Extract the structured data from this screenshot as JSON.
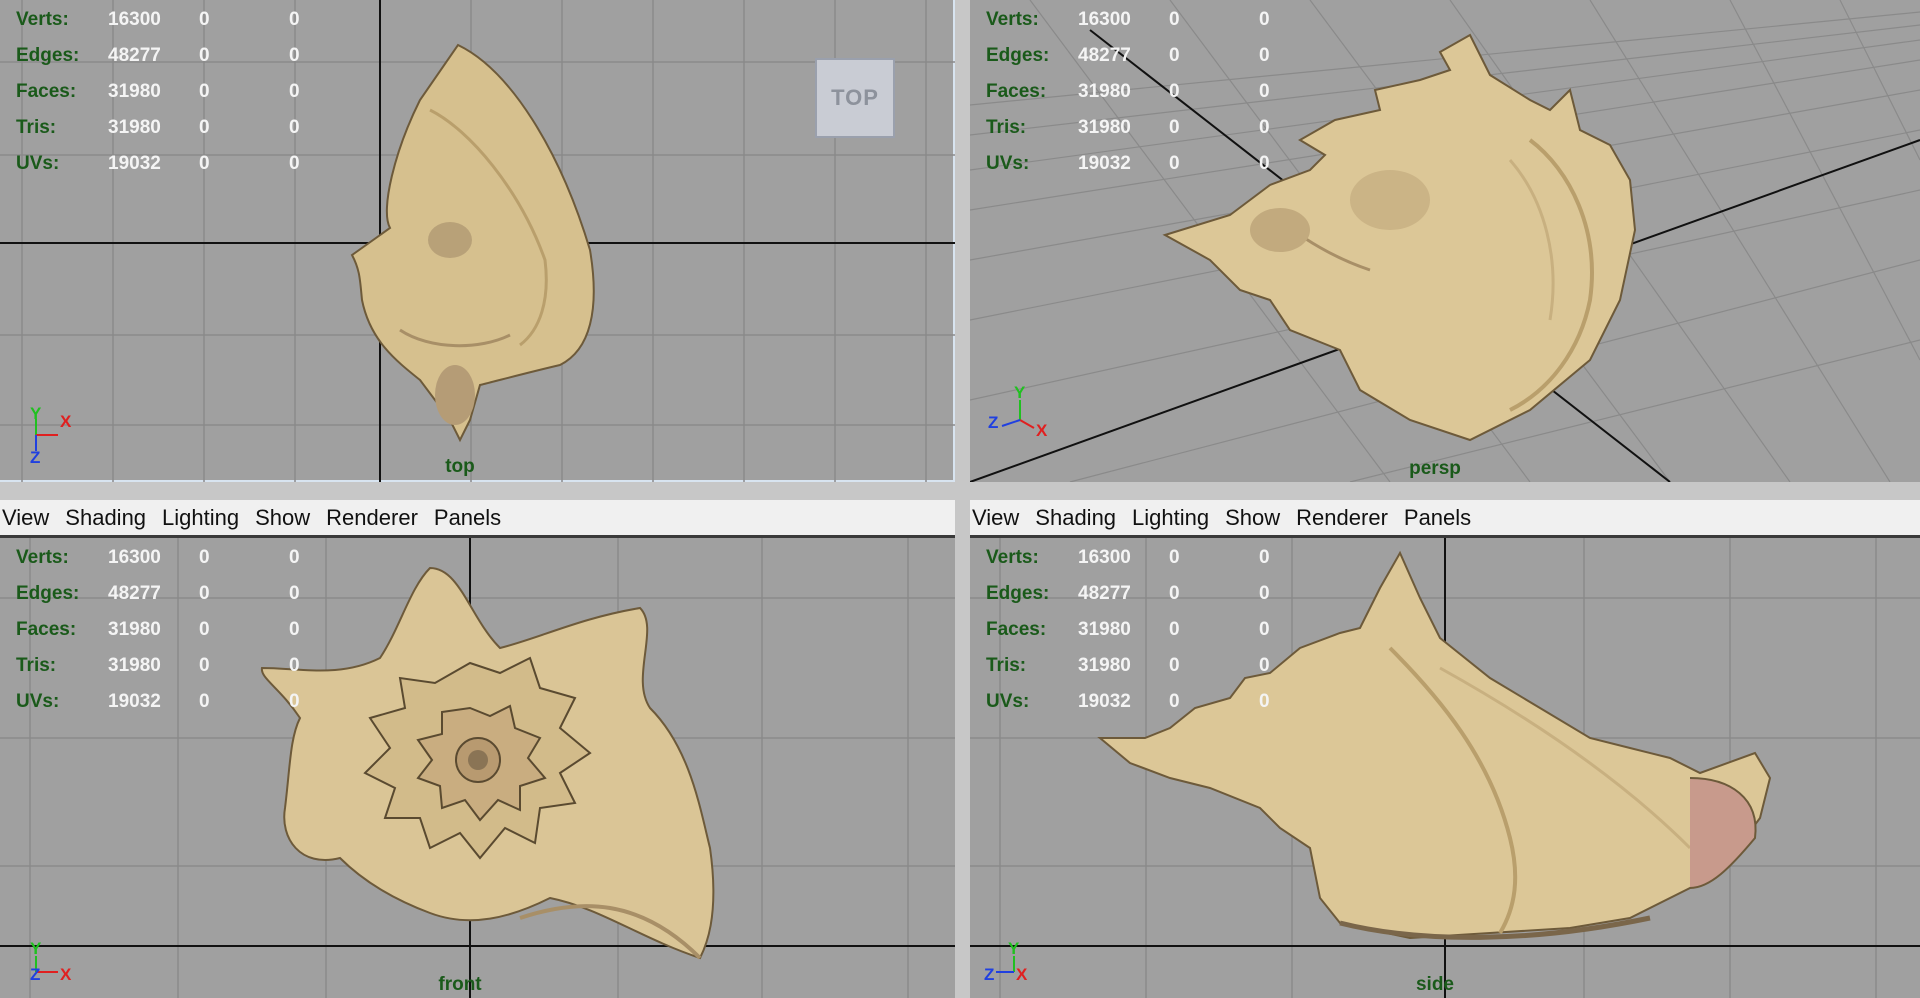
{
  "stats": {
    "labels": [
      "Verts:",
      "Edges:",
      "Faces:",
      "Tris:",
      "UVs:"
    ],
    "values": [
      "16300",
      "48277",
      "31980",
      "31980",
      "19032"
    ],
    "col2": "0",
    "col3": "0"
  },
  "menu": [
    "View",
    "Shading",
    "Lighting",
    "Show",
    "Renderer",
    "Panels"
  ],
  "viewports": {
    "top": {
      "camera": "top",
      "viewcube": "TOP"
    },
    "persp": {
      "camera": "persp"
    },
    "front": {
      "camera": "front"
    },
    "side": {
      "camera": "side"
    }
  },
  "axes": {
    "x": "X",
    "y": "Y",
    "z": "Z"
  },
  "colors": {
    "viewport_bg": "#a0a0a0",
    "grid_line": "#8a8a8a",
    "axis_line": "#111111",
    "hud_label": "#1a5a1a",
    "hud_value": "#f4f4f4",
    "axis_x": "#e02020",
    "axis_y": "#20c020",
    "axis_z": "#2040e0",
    "shell": "#d8c59a"
  }
}
